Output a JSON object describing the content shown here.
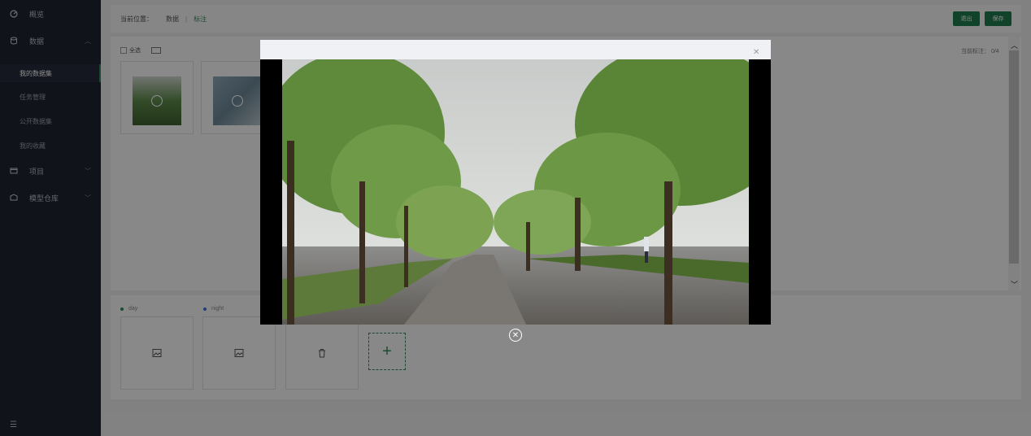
{
  "sidebar": {
    "items": [
      {
        "label": "概览",
        "icon": "gauge-icon"
      },
      {
        "label": "数据",
        "icon": "database-icon",
        "expanded": true,
        "children": [
          "我的数据集",
          "任务管理",
          "公开数据集",
          "我的收藏"
        ],
        "active_child": "我的数据集"
      },
      {
        "label": "项目",
        "icon": "folder-icon"
      },
      {
        "label": "模型仓库",
        "icon": "box-icon"
      }
    ],
    "collapse_icon": "menu-fold-icon"
  },
  "header": {
    "breadcrumb_prefix": "当前位置：",
    "crumbs": [
      "数据",
      "标注"
    ],
    "exit_label": "退出",
    "save_label": "保存"
  },
  "toolbar": {
    "select_all_label": "全选",
    "counter_label": "当前标注：",
    "counter_value": "0/4"
  },
  "labels": [
    {
      "name": "day",
      "color": "#2a8a58"
    },
    {
      "name": "night",
      "color": "#3a6fd8"
    }
  ],
  "colors": {
    "accent": "#1e7a4c",
    "sidebar_bg": "#1f2330"
  }
}
